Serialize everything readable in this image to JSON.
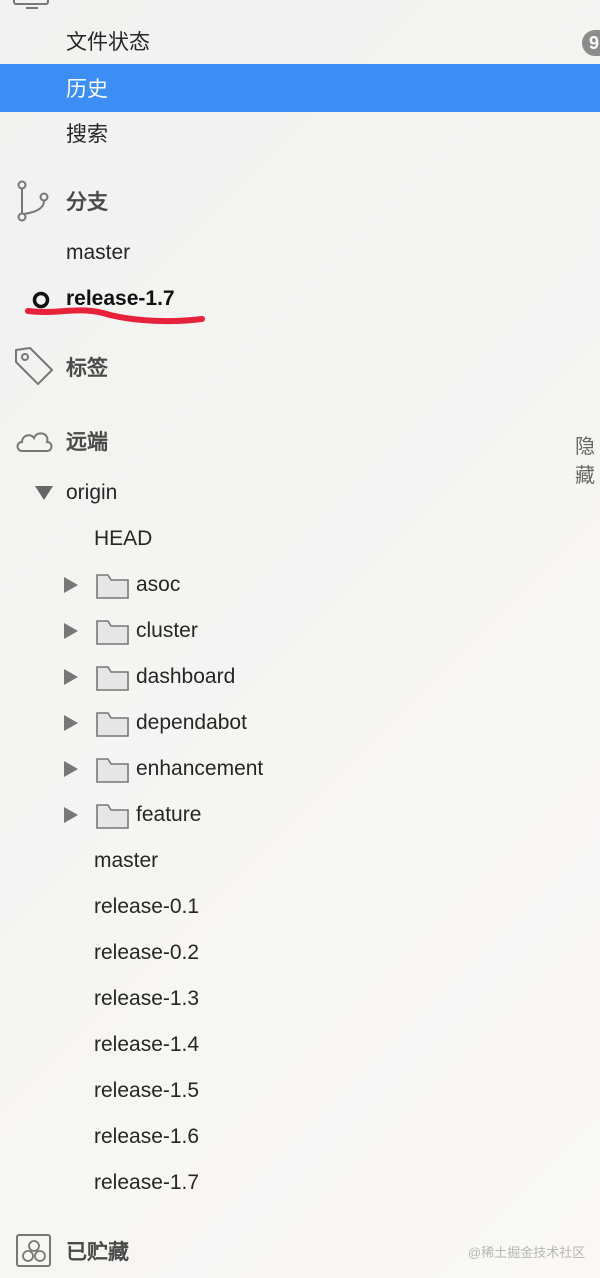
{
  "workspace": {
    "file_status": {
      "label": "文件状态",
      "badge": "9"
    },
    "history": {
      "label": "历史"
    },
    "search": {
      "label": "搜索"
    }
  },
  "branches": {
    "section_label": "分支",
    "items": [
      {
        "label": "master",
        "current": false
      },
      {
        "label": "release-1.7",
        "current": true
      }
    ]
  },
  "tags": {
    "section_label": "标签"
  },
  "remotes": {
    "section_label": "远端",
    "hide_label": "隐藏",
    "origin": {
      "label": "origin",
      "head": "HEAD",
      "folders": [
        "asoc",
        "cluster",
        "dashboard",
        "dependabot",
        "enhancement",
        "feature"
      ],
      "branches": [
        "master",
        "release-0.1",
        "release-0.2",
        "release-1.3",
        "release-1.4",
        "release-1.5",
        "release-1.6",
        "release-1.7"
      ]
    }
  },
  "stashes": {
    "section_label": "已贮藏"
  },
  "watermark": "@稀土掘金技术社区",
  "colors": {
    "selection": "#3d8ef4",
    "annotation_underline": "#e8213a"
  },
  "icons": {
    "workspace": "monitor-icon",
    "branches": "branch-icon",
    "tags": "tag-icon",
    "remotes": "cloud-icon",
    "stashes": "stash-icon",
    "current_branch": "current-branch-marker-icon",
    "folder": "folder-icon"
  }
}
